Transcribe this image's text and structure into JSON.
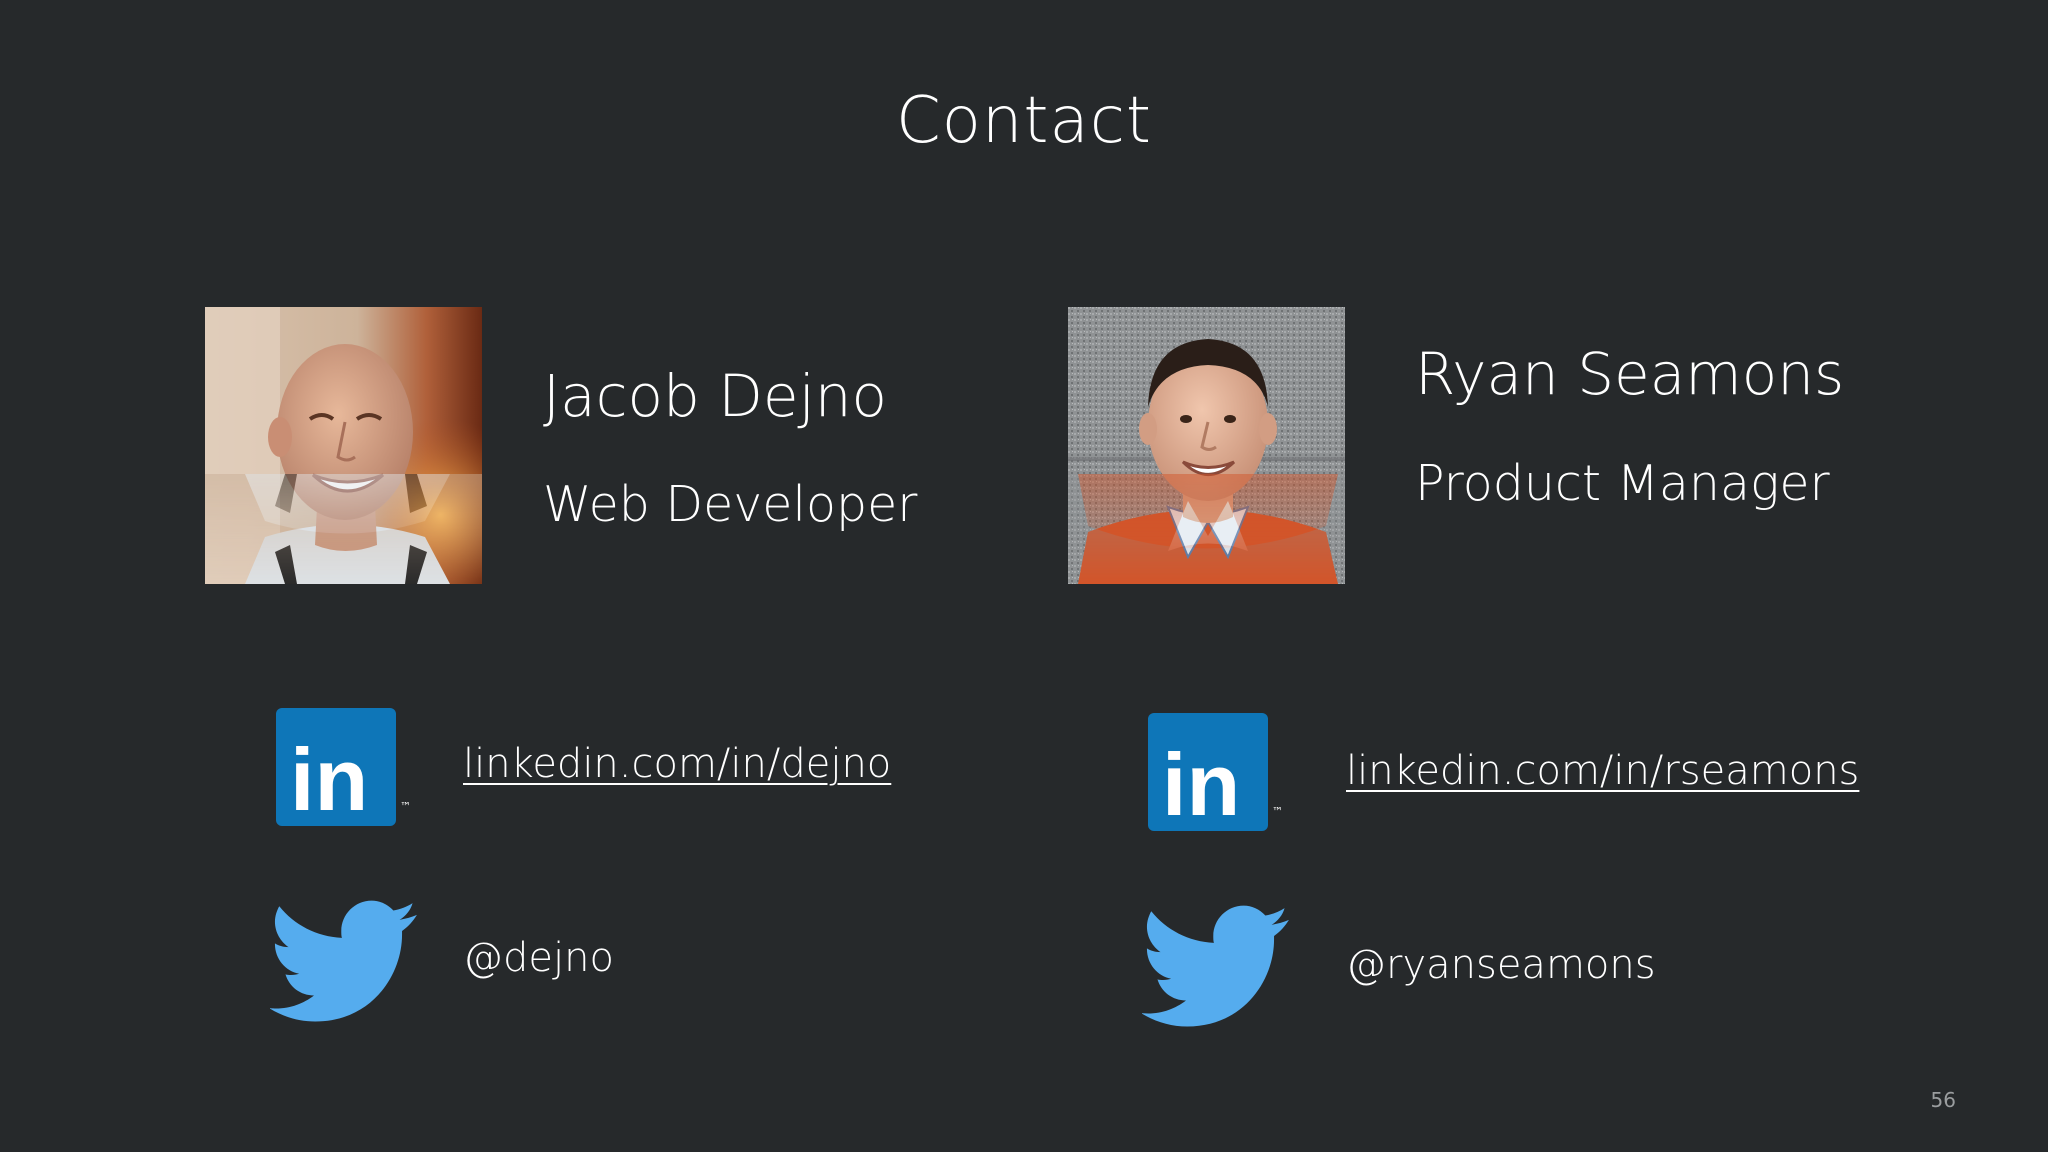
{
  "slide": {
    "title": "Contact",
    "page_number": "56"
  },
  "people": [
    {
      "name": "Jacob Dejno",
      "role": "Web Developer",
      "linkedin": "linkedin.com/in/dejno",
      "twitter": "@dejno"
    },
    {
      "name": "Ryan Seamons",
      "role": "Product Manager",
      "linkedin": "linkedin.com/in/rseamons",
      "twitter": "@ryanseamons"
    }
  ],
  "icons": {
    "linkedin": "linkedin-icon",
    "twitter": "twitter-bird-icon",
    "linkedin_mark": "in",
    "trademark": "™"
  },
  "colors": {
    "background": "#26292b",
    "linkedin_blue": "#0e76b8",
    "twitter_blue": "#55acee",
    "text": "#ffffff"
  }
}
